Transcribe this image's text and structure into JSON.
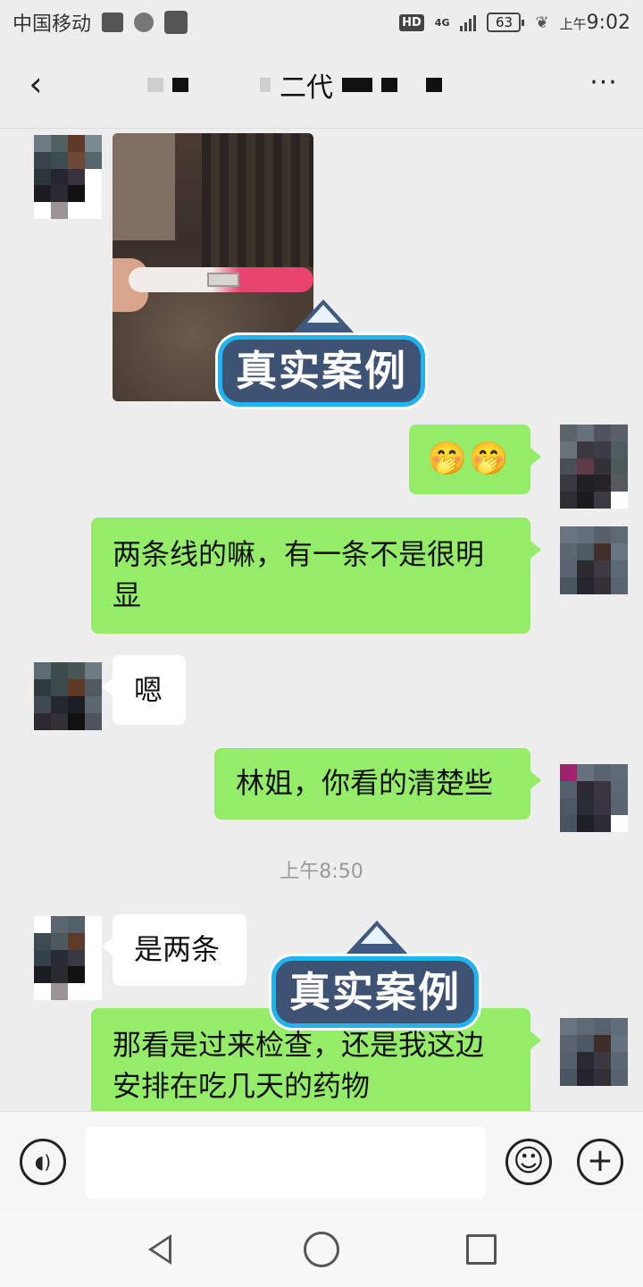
{
  "status_bar": {
    "carrier": "中国移动",
    "hd_label": "HD",
    "network": "4G",
    "battery": "63",
    "time_prefix": "上午",
    "time": "9:02"
  },
  "header": {
    "title": "二代",
    "back_icon": "chevron-left-icon",
    "more_icon": "more-dots-icon",
    "back_glyph": "‹",
    "more_glyph": "···"
  },
  "watermark": {
    "label": "真实案例"
  },
  "messages": [
    {
      "side": "in",
      "type": "image",
      "caption": ""
    },
    {
      "side": "out",
      "type": "text",
      "text": "🤭🤭"
    },
    {
      "side": "out",
      "type": "text",
      "text": "两条线的嘛，有一条不是很明显"
    },
    {
      "side": "in",
      "type": "text",
      "text": "嗯"
    },
    {
      "side": "out",
      "type": "text",
      "text": "林姐，你看的清楚些"
    },
    {
      "side": "in",
      "type": "text",
      "text": "是两条"
    },
    {
      "side": "out",
      "type": "text",
      "text": "那看是过来检查，还是我这边安排在吃几天的药物"
    }
  ],
  "timestamp": "上午8:50",
  "input_bar": {
    "voice_icon": "voice-icon",
    "emoji_icon": "emoji-icon",
    "plus_icon": "plus-icon",
    "voice_glyph": "◖)",
    "emoji_glyph": "☺",
    "plus_glyph": "+",
    "value": ""
  },
  "nav_bar": {
    "back_icon": "nav-back-icon",
    "home_icon": "nav-home-icon",
    "recent_icon": "nav-recent-icon"
  },
  "colors": {
    "background": "#ededed",
    "incoming_bubble": "#ffffff",
    "outgoing_bubble": "#95ec69",
    "watermark_border": "#1fb4ef",
    "watermark_fill": "#3e5273"
  }
}
